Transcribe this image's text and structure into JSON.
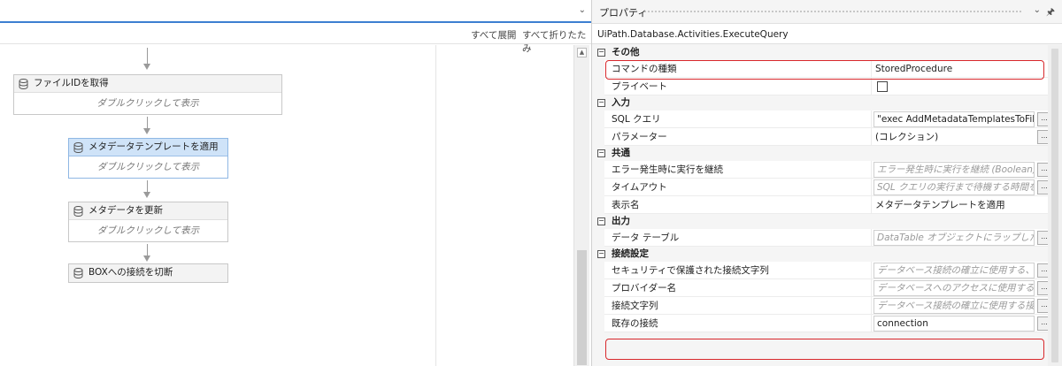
{
  "designer": {
    "toolbar": {
      "expand_all": "すべて展開",
      "collapse_all": "すべて折りたたみ"
    },
    "activities": [
      {
        "title": "ファイルIDを取得",
        "body": "ダブルクリックして表示"
      },
      {
        "title": "メタデータテンプレートを適用",
        "body": "ダブルクリックして表示",
        "selected": true
      },
      {
        "title": "メタデータを更新",
        "body": "ダブルクリックして表示"
      },
      {
        "title": "BOXへの接続を切断"
      }
    ]
  },
  "properties": {
    "title": "プロパティ",
    "type_name": "UiPath.Database.Activities.ExecuteQuery",
    "categories": {
      "misc": "その他",
      "input": "入力",
      "common": "共通",
      "output": "出力",
      "connection": "接続設定"
    },
    "rows": {
      "command_type": {
        "name": "コマンドの種類",
        "value": "StoredProcedure"
      },
      "private": {
        "name": "プライベート"
      },
      "sql": {
        "name": "SQL クエリ",
        "value": "\"exec AddMetadataTemplatesToFile"
      },
      "parameters": {
        "name": "パラメーター",
        "value": "(コレクション)"
      },
      "continue_on_error": {
        "name": "エラー発生時に実行を継続",
        "placeholder": "エラー発生時に実行を継続 (Boolean)"
      },
      "timeout": {
        "name": "タイムアウト",
        "placeholder": "SQL クエリの実行まで待機する時間をミ"
      },
      "display_name": {
        "name": "表示名",
        "value": "メタデータテンプレートを適用"
      },
      "data_table": {
        "name": "データ テーブル",
        "placeholder": "DataTable オブジェクトにラップした SQL ."
      },
      "secure_conn": {
        "name": "セキュリティで保護された接続文字列",
        "placeholder": "データベース接続の確立に使用する、Sec"
      },
      "provider": {
        "name": "プロバイダー名",
        "placeholder": "データベースへのアクセスに使用するデータ"
      },
      "conn_string": {
        "name": "接続文字列",
        "placeholder": "データベース接続の確立に使用する接続"
      },
      "existing_conn": {
        "name": "既存の接続",
        "value": "connection"
      }
    },
    "ellipsis": "..."
  },
  "colors": {
    "accent": "#3c7fd1",
    "highlight": "#d8282c",
    "selected": "#cfe3f8"
  }
}
